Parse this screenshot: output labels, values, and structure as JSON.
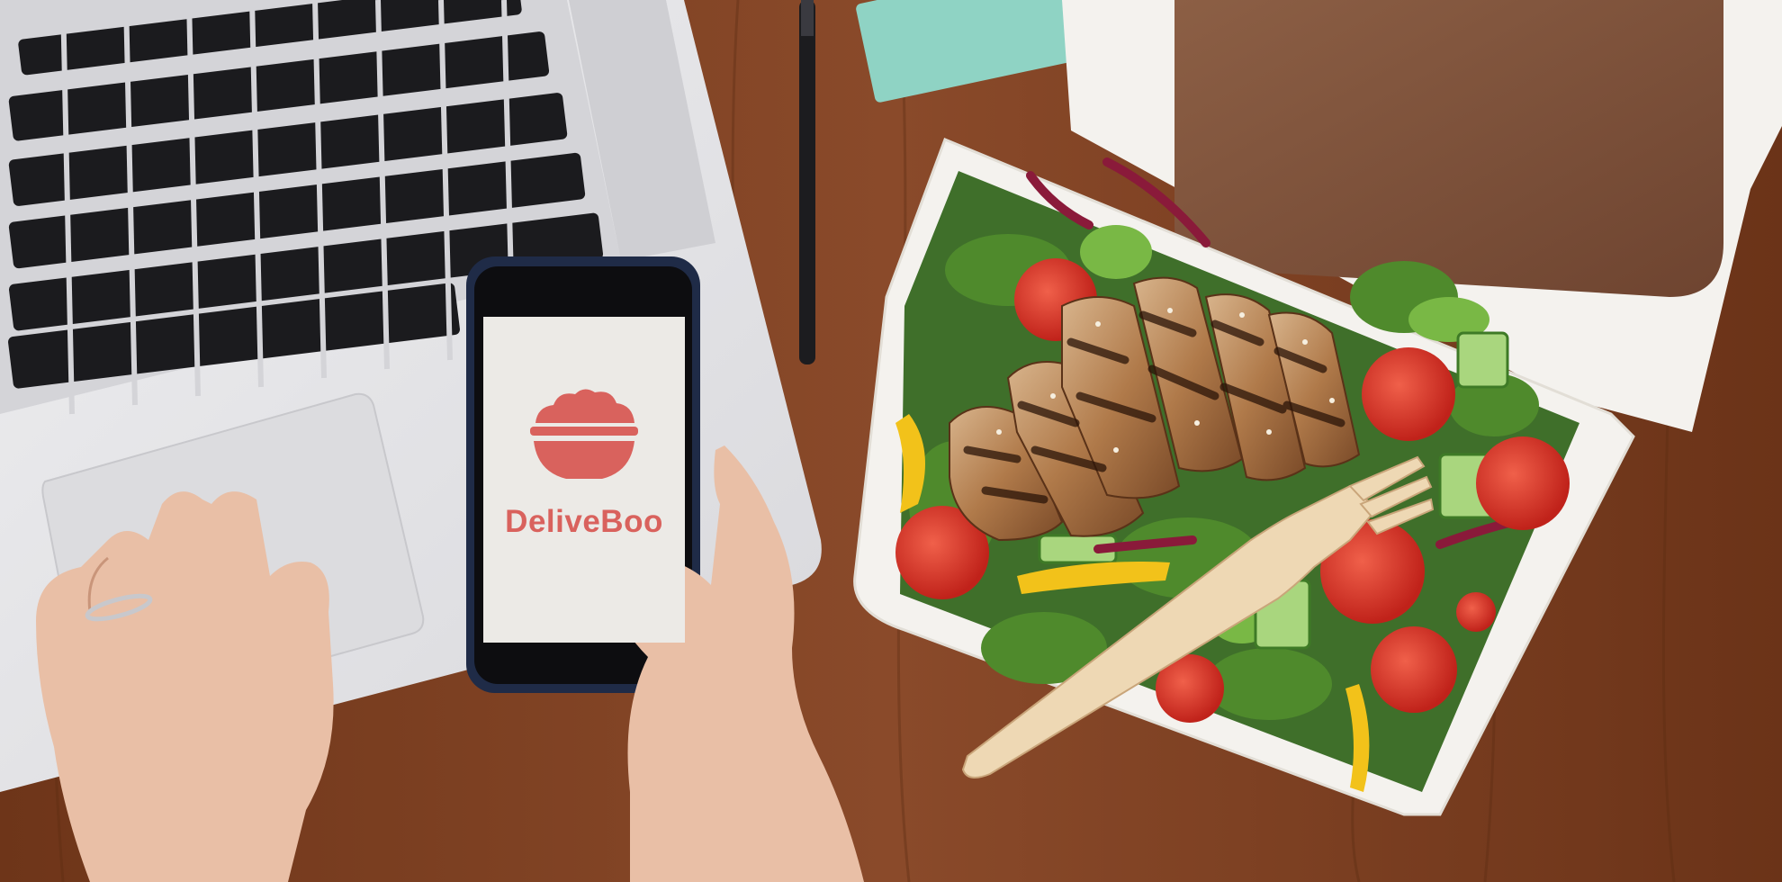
{
  "app": {
    "brand_name": "DeliveBoo",
    "brand_color": "#d9625d",
    "logo_icon": "food-bowl-icon",
    "screen_background": "#eceae6"
  },
  "scene": {
    "desk_color": "#7a3e22",
    "laptop_color": "#e6e6e8",
    "phone_case_color": "#1f2b47",
    "box_color": "#f4f2ee"
  }
}
